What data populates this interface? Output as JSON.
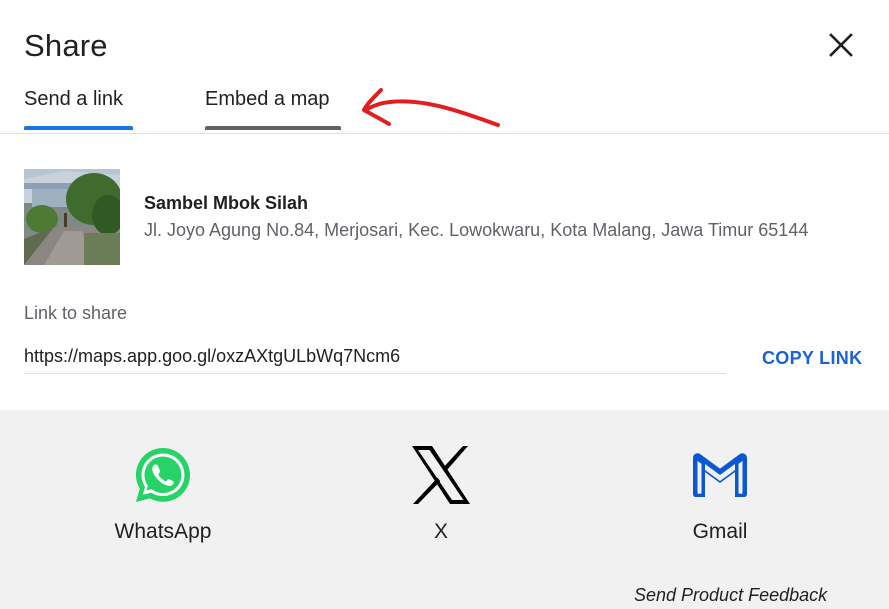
{
  "dialog": {
    "title": "Share",
    "close_icon": "close-icon"
  },
  "tabs": [
    {
      "label": "Send a link",
      "active": true
    },
    {
      "label": "Embed a map",
      "active": false
    }
  ],
  "place": {
    "name": "Sambel Mbok Silah",
    "address": "Jl. Joyo Agung No.84, Merjosari, Kec. Lowokwaru, Kota Malang, Jawa Timur 65144"
  },
  "link": {
    "label": "Link to share",
    "value": "https://maps.app.goo.gl/oxzAXtgULbWq7Ncm6",
    "copy_label": "COPY LINK"
  },
  "share_targets": [
    {
      "label": "WhatsApp",
      "icon": "whatsapp-icon"
    },
    {
      "label": "X",
      "icon": "x-icon"
    },
    {
      "label": "Gmail",
      "icon": "gmail-icon"
    }
  ],
  "feedback": "Send Product Feedback",
  "colors": {
    "active_tab": "#1a73e8",
    "copy_link": "#1a62d6",
    "whatsapp": "#25d366",
    "annotation": "#e02020"
  }
}
